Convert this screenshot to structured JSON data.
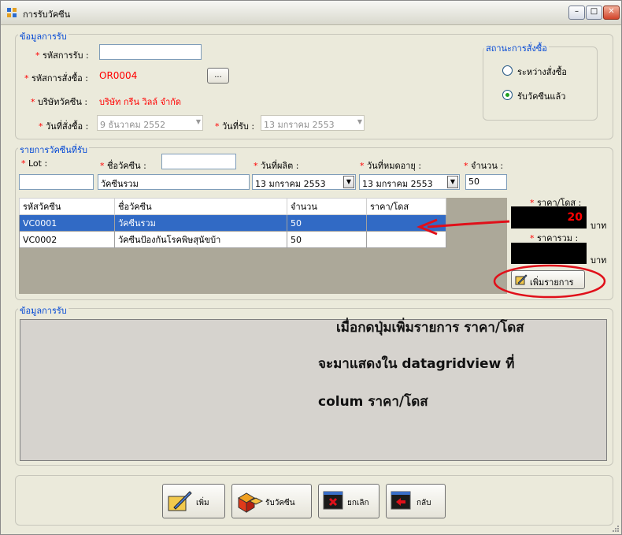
{
  "window": {
    "title": "การรับวัคซีน",
    "controls": {
      "minimize": "–",
      "maximize": "□",
      "close": "✕"
    }
  },
  "receive_info": {
    "group_title": "ข้อมูลการรับ",
    "receive_code_label": "รหัสการรับ :",
    "receive_code_value": "",
    "order_code_label": "รหัสการสั่งซื้อ :",
    "order_code_value": "OR0004",
    "browse_button": "...",
    "company_label": "บริษัทวัคซีน :",
    "company_value": "บริษัท กรีน วิลล์ จำกัด",
    "order_date_label": "วันที่สั่งซื้อ :",
    "order_date_value": "9  ธันวาคม   2552",
    "receive_date_label": "วันที่รับ :",
    "receive_date_value": "13  มกราคม   2553"
  },
  "order_status": {
    "group_title": "สถานะการสั่งซื้อ",
    "option_ordering": "ระหว่างสั่งซื้อ",
    "option_received": "รับวัคซีนแล้ว",
    "selected": "received"
  },
  "vaccine_list": {
    "group_title": "รายการวัคซีนที่รับ",
    "lot_label": "Lot :",
    "lot_value": "",
    "name_label": "ชื่อวัคซีน :",
    "name_small_value": "",
    "name_value": "วัคซีนรวม",
    "mfg_label": "วันที่ผลิต :",
    "mfg_value": "13  มกราคม    2553",
    "exp_label": "วันที่หมดอายุ :",
    "exp_value": "13  มกราคม    2553",
    "qty_label": "จำนวน :",
    "qty_value": "50",
    "columns": [
      "รหัสวัคซีน",
      "ชื่อวัคซีน",
      "จำนวน",
      "ราคา/โดส"
    ],
    "rows": [
      [
        "VC0001",
        "วัคซีนรวม",
        "50",
        ""
      ],
      [
        "VC0002",
        "วัคซีนป้องกันโรคพิษสุนัขบ้า",
        "50",
        ""
      ]
    ],
    "price_label": "ราคา/โดส :",
    "price_value": "20",
    "price_unit": "บาท",
    "total_label": "ราคารวม :",
    "total_value": "",
    "total_unit": "บาท",
    "add_item_button": "เพิ่มรายการ"
  },
  "receive_info_2": {
    "group_title": "ข้อมูลการรับ"
  },
  "annotation": {
    "line1": "เมื่อกดปุ่มเพิ่มรายการ ราคา/โดส",
    "line2": "จะมาแสดงใน datagridview ที่",
    "line3": "colum ราคา/โดส"
  },
  "bottom_buttons": {
    "add": "เพิ่ม",
    "receive": "รับวัคซีน",
    "cancel": "ยกเลิก",
    "back": "กลับ"
  },
  "colors": {
    "accent": "#0046d5",
    "required": "#ff0000",
    "selection": "#316ac5",
    "annotation": "#e0101a"
  }
}
